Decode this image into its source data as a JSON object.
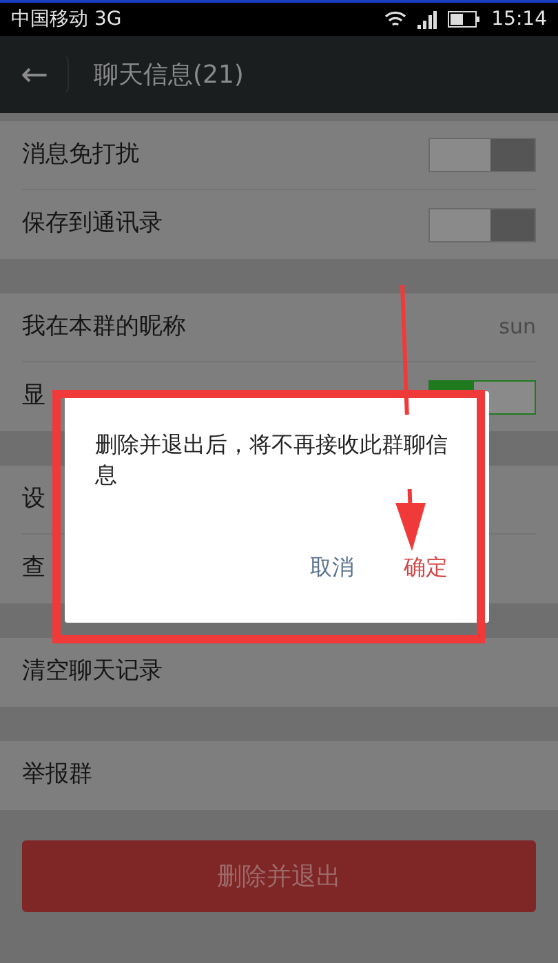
{
  "status_bar": {
    "carrier": "中国移动 3G",
    "time": "15:14"
  },
  "header": {
    "back": "←",
    "title": "聊天信息(21)"
  },
  "sections": [
    {
      "rows": [
        {
          "kind": "toggle",
          "label": "消息免打扰",
          "on": false
        },
        {
          "kind": "toggle",
          "label": "保存到通讯录",
          "on": false
        }
      ]
    },
    {
      "rows": [
        {
          "kind": "value",
          "label": "我在本群的昵称",
          "value": "sun"
        },
        {
          "kind": "toggle",
          "label": "显",
          "on": true
        }
      ]
    },
    {
      "rows": [
        {
          "kind": "plain",
          "label": "设"
        },
        {
          "kind": "plain",
          "label": "查"
        }
      ]
    },
    {
      "rows": [
        {
          "kind": "plain",
          "label": "清空聊天记录"
        }
      ]
    },
    {
      "rows": [
        {
          "kind": "plain",
          "label": "举报群"
        }
      ]
    }
  ],
  "exit_button": "删除并退出",
  "dialog": {
    "message": "删除并退出后，将不再接收此群聊信息",
    "buttons": [
      {
        "kind": "cancel",
        "label": "取消"
      },
      {
        "kind": "confirm",
        "label": "确定"
      }
    ]
  }
}
